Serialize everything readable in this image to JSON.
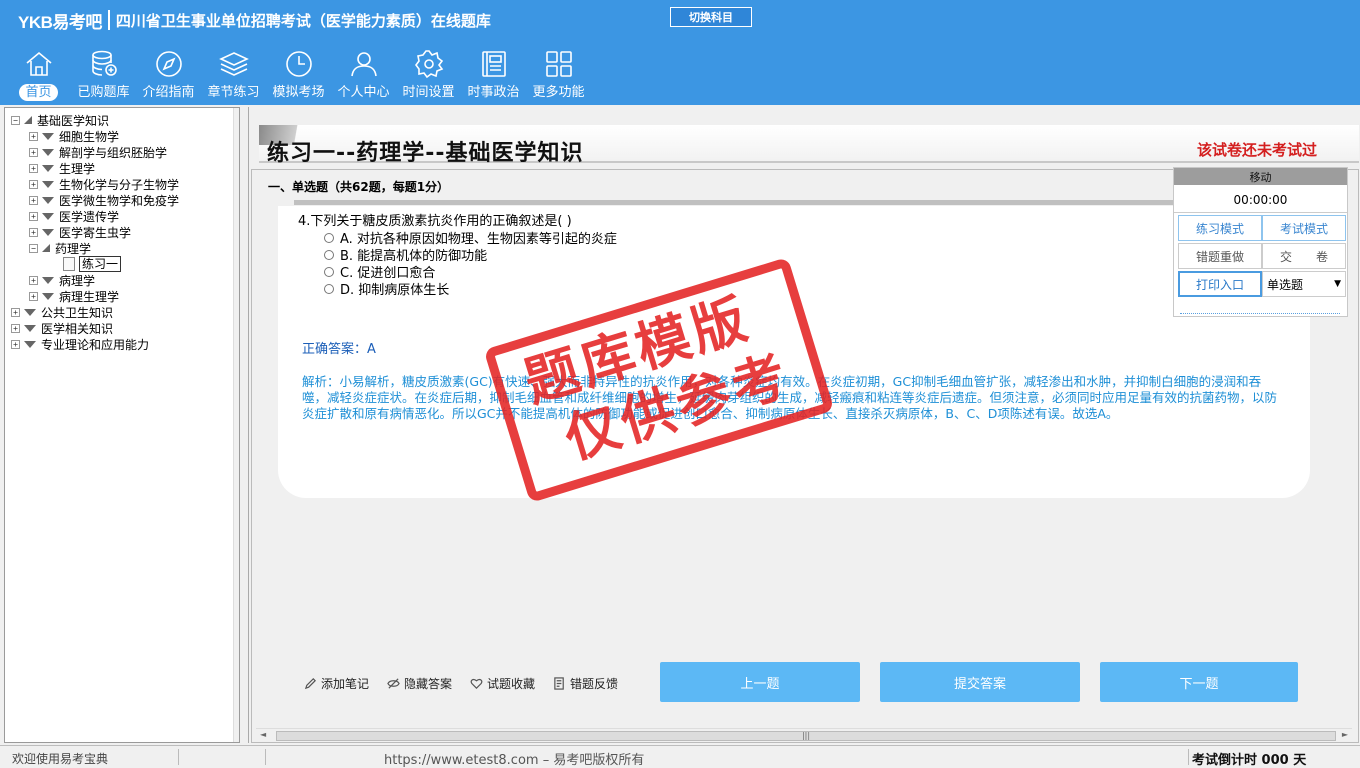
{
  "header": {
    "logo": "YKB易考吧",
    "title": "四川省卫生事业单位招聘考试（医学能力素质）在线题库",
    "switch_label": "切换科目"
  },
  "nav": [
    {
      "label": "首页",
      "icon": "home-icon"
    },
    {
      "label": "已购题库",
      "icon": "database-icon"
    },
    {
      "label": "介绍指南",
      "icon": "compass-icon"
    },
    {
      "label": "章节练习",
      "icon": "layers-icon"
    },
    {
      "label": "模拟考场",
      "icon": "clock-icon"
    },
    {
      "label": "个人中心",
      "icon": "user-icon"
    },
    {
      "label": "时间设置",
      "icon": "gear-icon"
    },
    {
      "label": "时事政治",
      "icon": "news-icon"
    },
    {
      "label": "更多功能",
      "icon": "grid-icon"
    }
  ],
  "tree": {
    "root": "基础医学知识",
    "children": [
      "细胞生物学",
      "解剖学与组织胚胎学",
      "生理学",
      "生物化学与分子生物学",
      "医学微生物学和免疫学",
      "医学遗传学",
      "医学寄生虫学",
      "药理学"
    ],
    "selected_leaf": "练习一",
    "after": [
      "病理学",
      "病理生理学"
    ],
    "top_level": [
      "公共卫生知识",
      "医学相关知识",
      "专业理论和应用能力"
    ]
  },
  "main": {
    "paper_title": "练习一--药理学--基础医学知识",
    "status": "该试卷还未考试过",
    "section": "一、单选题（共62题，每题1分）",
    "question": "4.下列关于糖皮质激素抗炎作用的正确叙述是( )",
    "options": [
      "A. 对抗各种原因如物理、生物因素等引起的炎症",
      "B. 能提高机体的防御功能",
      "C. 促进创口愈合",
      "D. 抑制病原体生长"
    ],
    "answer": "正确答案：A",
    "analysis": "解析：小易解析，糖皮质激素(GC)有快速、强大而非特异性的抗炎作用，对各种炎症均有效。在炎症初期，GC抑制毛细血管扩张，减轻渗出和水肿，并抑制白细胞的浸润和吞噬，减轻炎症症状。在炎症后期，抑制毛细血管和成纤维细胞的增生，延缓肉芽组织的生成，减轻瘢痕和粘连等炎症后遗症。但须注意，必须同时应用足量有效的抗菌药物，以防炎症扩散和原有病情恶化。所以GC并不能提高机体的防御功能或促进创口愈合、抑制病原体生长、直接杀灭病原体，B、C、D项陈述有误。故选A。",
    "tools": [
      "添加笔记",
      "隐藏答案",
      "试题收藏",
      "错题反馈"
    ],
    "prev": "上一题",
    "submit": "提交答案",
    "next": "下一题"
  },
  "panel": {
    "move": "移动",
    "timer": "00:00:00",
    "practice_mode": "练习模式",
    "exam_mode": "考试模式",
    "redo_wrong": "错题重做",
    "hand_in": "交　　卷",
    "print": "打印入口",
    "question_type": "单选题"
  },
  "stamp": {
    "line1": "题库模版",
    "line2": "仅供参考"
  },
  "status": {
    "welcome": "欢迎使用易考宝典",
    "copyright": "https://www.etest8.com – 易考吧版权所有",
    "countdown": "考试倒计时 000 天"
  },
  "colors": {
    "header_bg": "#3c96e3",
    "button_bg": "#5cb8f5",
    "status_red": "#d41f1f",
    "answer_blue": "#1c5fb8",
    "analysis_blue": "#1e8fd6",
    "stamp_red": "#e42424"
  }
}
